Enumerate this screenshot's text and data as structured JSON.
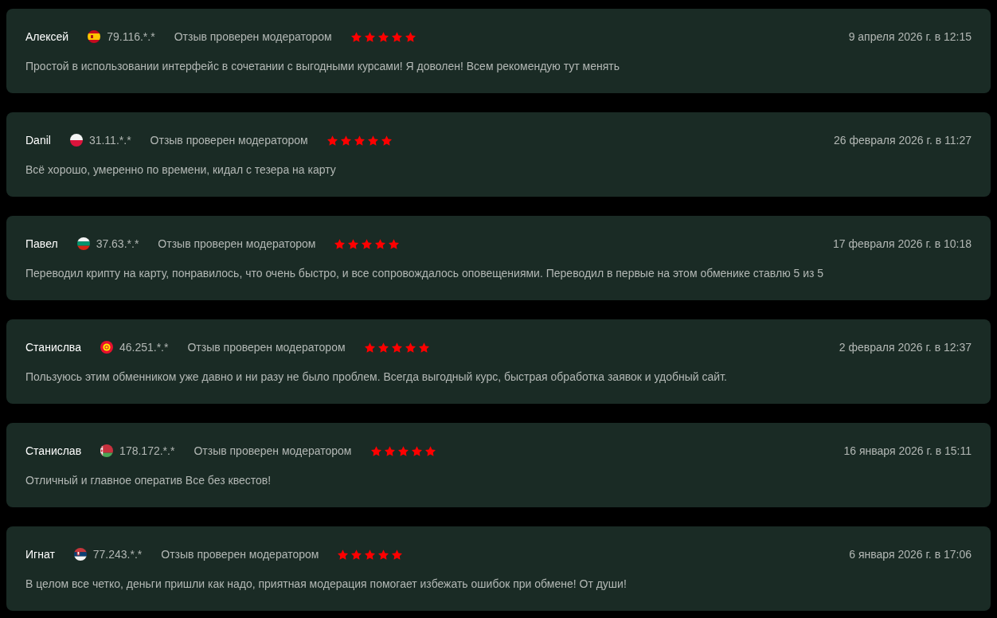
{
  "reviews": [
    {
      "kind": "spain",
      "author": "Алексей",
      "ip": "79.116.*.*",
      "verified": "Отзыв проверен модератором",
      "stars": 5,
      "date": "9 апреля 2026 г. в 12:15",
      "text": "Простой в использовании интерфейс в сочетании с выгодными курсами! Я доволен! Всем рекомендую тут менять"
    },
    {
      "kind": "poland",
      "author": "Danil",
      "ip": "31.11.*.*",
      "verified": "Отзыв проверен модератором",
      "stars": 5,
      "date": "26 февраля 2026 г. в 11:27",
      "text": "Всё хорошо, умеренно по времени, кидал с тезера на карту"
    },
    {
      "kind": "bulgaria",
      "author": "Павел",
      "ip": "37.63.*.*",
      "verified": "Отзыв проверен модератором",
      "stars": 5,
      "date": "17 февраля 2026 г. в 10:18",
      "text": "Переводил крипту на карту, понравилось, что очень быстро, и все сопровождалось оповещениями. Переводил в первые на этом обменике ставлю 5 из 5"
    },
    {
      "kind": "kyrgyzstan",
      "author": "Станислва",
      "ip": "46.251.*.*",
      "verified": "Отзыв проверен модератором",
      "stars": 5,
      "date": "2 февраля 2026 г. в 12:37",
      "text": "Пользуюсь этим обменником уже давно и ни разу не было проблем. Всегда выгодный курс, быстрая обработка заявок и удобный сайт."
    },
    {
      "kind": "belarus",
      "author": "Станислав",
      "ip": "178.172.*.*",
      "verified": "Отзыв проверен модератором",
      "stars": 5,
      "date": "16 января 2026 г. в 15:11",
      "text": "Отличный и главное оператив Все без квестов!"
    },
    {
      "kind": "serbia",
      "author": "Игнат",
      "ip": "77.243.*.*",
      "verified": "Отзыв проверен модератором",
      "stars": 5,
      "date": "6 января 2026 г. в 17:06",
      "text": "В целом все четко, деньги пришли как надо, приятная модерация помогает избежать ошибок при обмене! От души!"
    }
  ]
}
